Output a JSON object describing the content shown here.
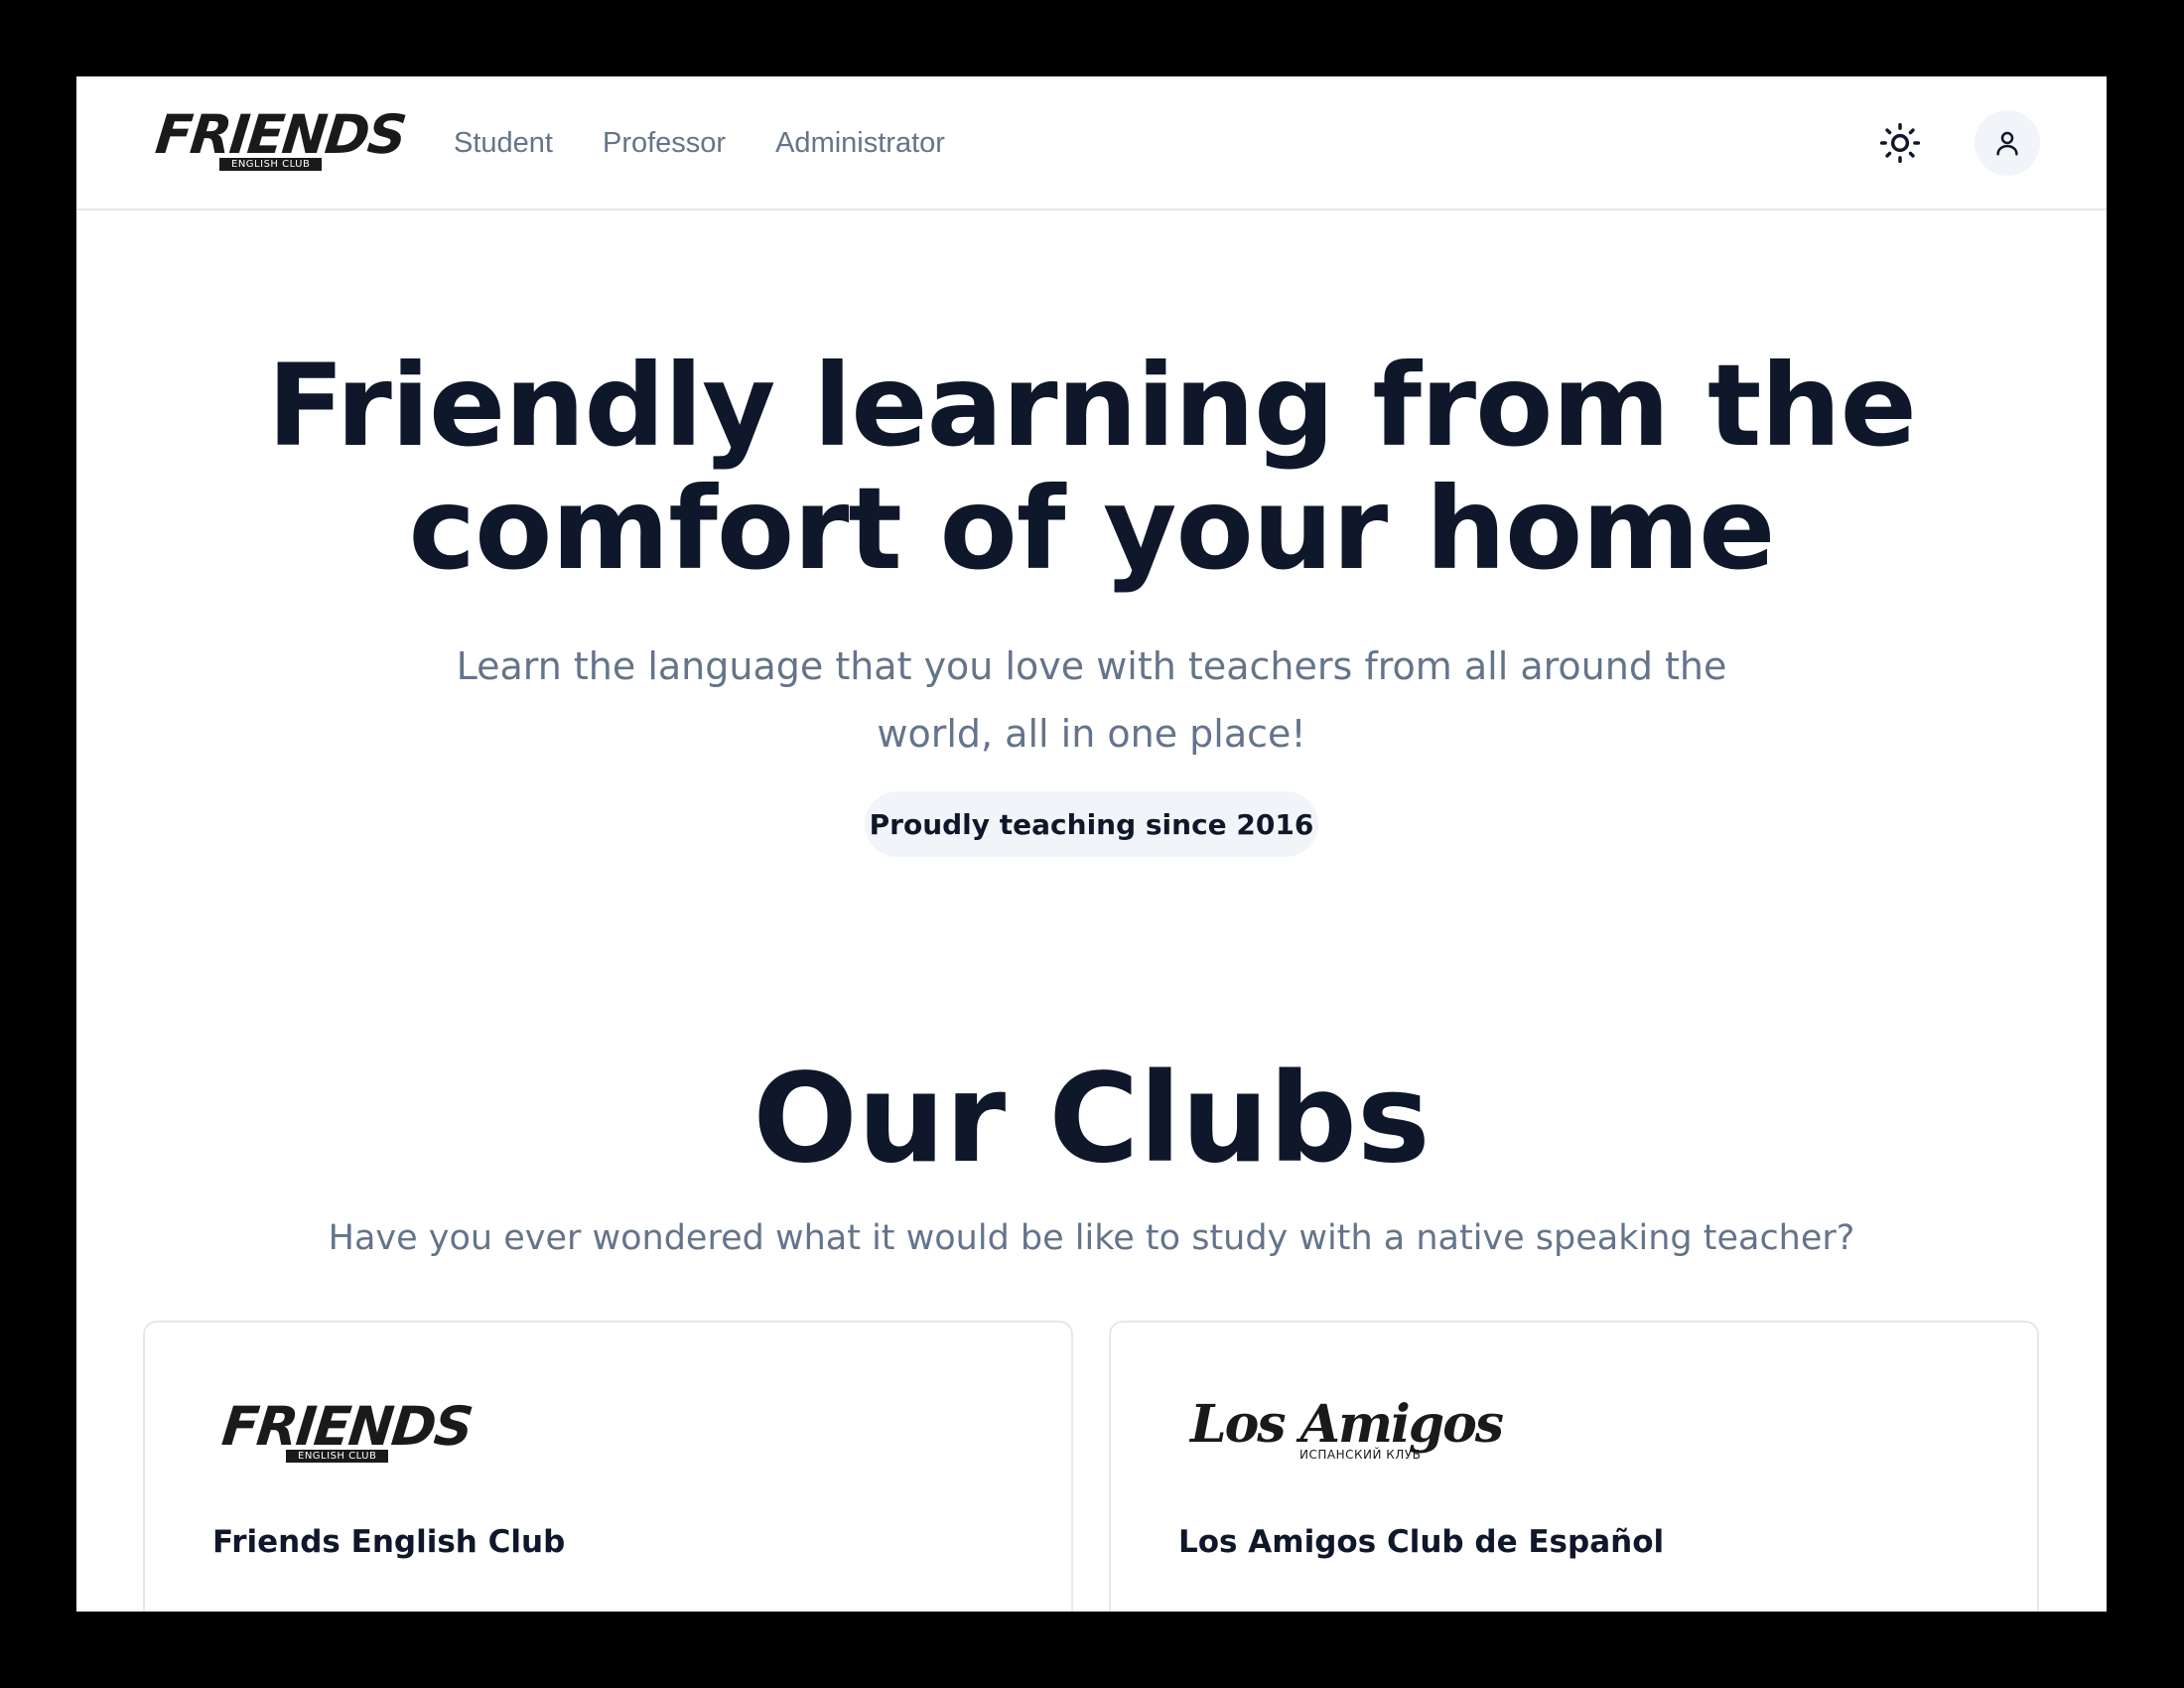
{
  "header": {
    "logo": {
      "word": "FRIENDS",
      "sub": "ENGLISH CLUB"
    },
    "nav": [
      {
        "label": "Student"
      },
      {
        "label": "Professor"
      },
      {
        "label": "Administrator"
      }
    ],
    "theme_icon": "sun-icon",
    "account_icon": "user-icon"
  },
  "hero": {
    "title_line1": "Friendly learning from the",
    "title_line2": "comfort of your home",
    "subtitle": "Learn the language that you love with teachers from all around the world, all in one place!",
    "badge": "Proudly teaching since 2016"
  },
  "clubs": {
    "title": "Our Clubs",
    "subtitle": "Have you ever wondered what it would be like to study with a native speaking teacher?",
    "cards": [
      {
        "logo_word": "FRIENDS",
        "logo_sub": "ENGLISH CLUB",
        "name": "Friends English Club"
      },
      {
        "logo_word": "Los Amigos",
        "logo_sub": "ИСПАНСКИЙ КЛУБ",
        "name": "Los Amigos Club de Español"
      }
    ]
  },
  "colors": {
    "heading": "#0f172a",
    "muted": "#64748b",
    "badge_bg": "#f1f5f9",
    "border": "#e2e8f0"
  }
}
